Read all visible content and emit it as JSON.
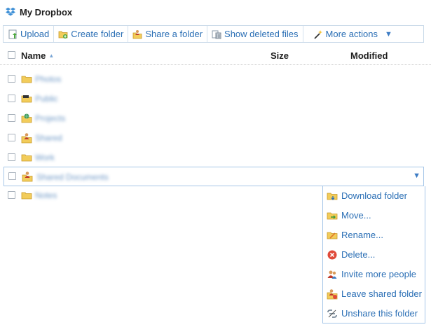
{
  "header_title": "My Dropbox",
  "toolbar": {
    "upload": "Upload",
    "create_folder": "Create folder",
    "share_folder": "Share a folder",
    "show_deleted": "Show deleted files",
    "more_actions": "More actions"
  },
  "columns": {
    "name": "Name",
    "size": "Size",
    "modified": "Modified"
  },
  "files": [
    {
      "name": "Photos",
      "icon": "folder-icon"
    },
    {
      "name": "Public",
      "icon": "public-folder-icon"
    },
    {
      "name": "Projects",
      "icon": "shared-globe-folder-icon"
    },
    {
      "name": "Shared",
      "icon": "shared-folder-icon"
    },
    {
      "name": "Work",
      "icon": "folder-icon"
    },
    {
      "name": "Shared Documents",
      "icon": "shared-folder-icon"
    },
    {
      "name": "Notes",
      "icon": "folder-icon"
    }
  ],
  "context_menu": {
    "download": "Download folder",
    "move": "Move...",
    "rename": "Rename...",
    "delete": "Delete...",
    "invite": "Invite more people",
    "leave": "Leave shared folder",
    "unshare": "Unshare this folder"
  },
  "colors": {
    "link": "#2b6fb5",
    "border": "#a6c6e8"
  }
}
